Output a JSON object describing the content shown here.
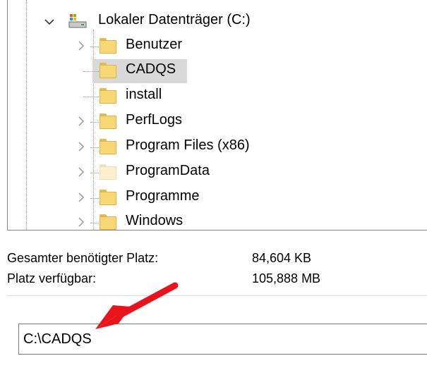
{
  "tree": {
    "drive": {
      "label": "Lokaler Datenträger (C:)",
      "icon": "drive-icon",
      "expanded": true
    },
    "items": [
      {
        "label": "Benutzer",
        "has_children": true,
        "selected": false,
        "icon": "folder-icon"
      },
      {
        "label": "CADQS",
        "has_children": false,
        "selected": true,
        "icon": "folder-icon"
      },
      {
        "label": "install",
        "has_children": false,
        "selected": false,
        "icon": "folder-icon"
      },
      {
        "label": "PerfLogs",
        "has_children": true,
        "selected": false,
        "icon": "folder-icon"
      },
      {
        "label": "Program Files (x86)",
        "has_children": true,
        "selected": false,
        "icon": "folder-icon"
      },
      {
        "label": "ProgramData",
        "has_children": true,
        "selected": false,
        "icon": "folder-icon-faded"
      },
      {
        "label": "Programme",
        "has_children": true,
        "selected": false,
        "icon": "folder-icon"
      },
      {
        "label": "Windows",
        "has_children": true,
        "selected": false,
        "icon": "folder-icon"
      }
    ]
  },
  "space": {
    "required_label": "Gesamter benötigter Platz:",
    "required_value": "84,604 KB",
    "available_label": "Platz verfügbar:",
    "available_value": "105,888 MB"
  },
  "path": {
    "value": "C:\\CADQS"
  },
  "annotation": {
    "arrow_color": "#e8131b"
  }
}
